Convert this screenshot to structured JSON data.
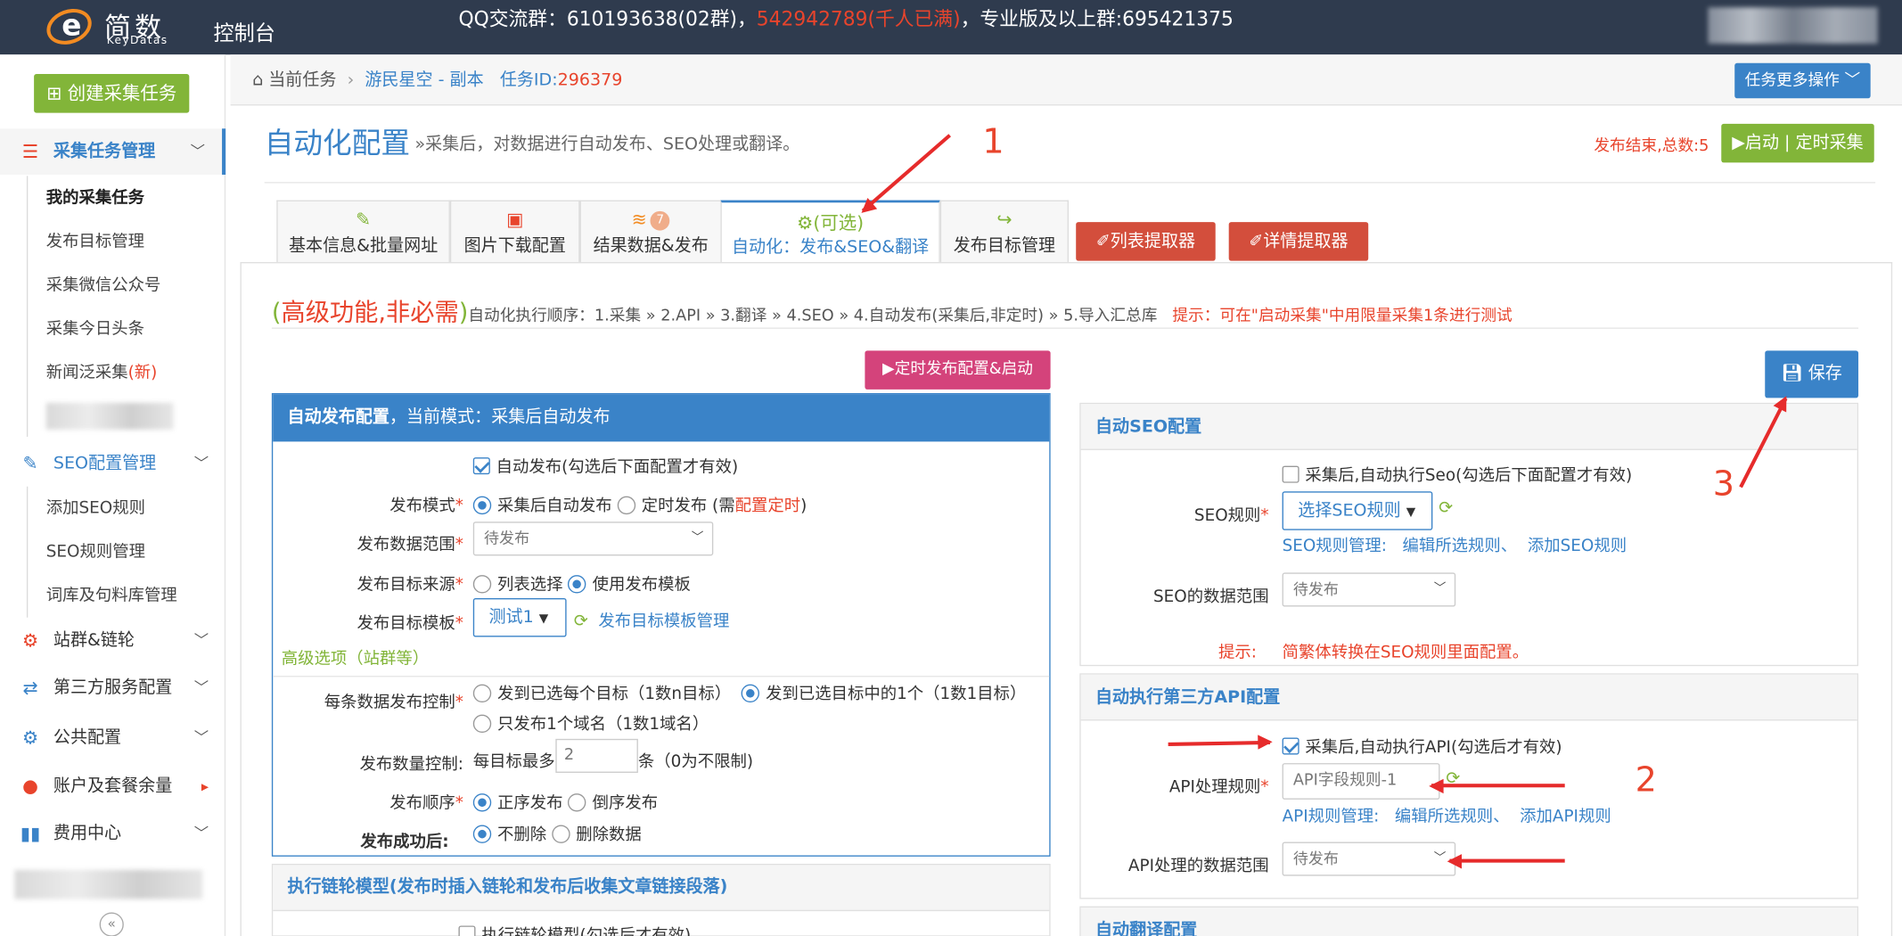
{
  "topbar": {
    "logo_text": "简数",
    "logo_sub": "KeyDatas",
    "console_label": "控制台",
    "qq_prefix": "QQ交流群：610193638(02群)，",
    "qq_full": "542942789(千人已满)",
    "qq_suffix": "，专业版及以上群:695421375"
  },
  "sidebar": {
    "create_button": "创建采集任务",
    "groups": [
      {
        "label": "采集任务管理",
        "icon": "list-icon"
      },
      {
        "label": "SEO配置管理",
        "icon": "edit-icon"
      },
      {
        "label": "站群&链轮",
        "icon": "gears-icon"
      },
      {
        "label": "第三方服务配置",
        "icon": "exchange-icon"
      },
      {
        "label": "公共配置",
        "icon": "gear-icon"
      },
      {
        "label": "账户及套餐余量",
        "icon": "user-icon"
      },
      {
        "label": "费用中心",
        "icon": "bar-chart-icon"
      }
    ],
    "task_items": [
      "我的采集任务",
      "发布目标管理",
      "采集微信公众号",
      "采集今日头条",
      "新闻泛采集"
    ],
    "new_tag": "(新)",
    "seo_items": [
      "添加SEO规则",
      "SEO规则管理",
      "词库及句料库管理"
    ]
  },
  "breadcrumb": {
    "home": "当前任务",
    "task_name": "游民星空 - 副本",
    "task_id_label": "任务ID:",
    "task_id": "296379",
    "more_ops": "任务更多操作"
  },
  "header": {
    "title": "自动化配置",
    "subtitle": "»采集后，对数据进行自动发布、SEO处理或翻译。",
    "publish_end": "发布结束,总数:5",
    "start_button": "▶启动 | 定时采集"
  },
  "tabs": [
    {
      "label": "基本信息&批量网址",
      "icon": "edit-icon"
    },
    {
      "label": "图片下载配置",
      "icon": "image-icon"
    },
    {
      "label": "结果数据&发布",
      "icon": "database-icon",
      "badge": "7"
    },
    {
      "label": "自动化：发布&SEO&翻译",
      "top": "(可选)",
      "icon": "gears-icon"
    },
    {
      "label": "发布目标管理",
      "icon": "share-icon"
    }
  ],
  "extractors": [
    "列表提取器",
    "详情提取器"
  ],
  "advanced": {
    "big": "高级功能,非必需",
    "order": "自动化执行顺序：1.采集 » 2.API » 3.翻译 » 4.SEO » 4.自动发布(采集后,非定时) » 5.导入汇总库",
    "tip": "提示：可在\"启动采集\"中用限量采集1条进行测试"
  },
  "buttons": {
    "schedule": "▶定时发布配置&启动",
    "save": "保存"
  },
  "publish": {
    "head_bold": "自动发布配置",
    "head_rest": "，当前模式：采集后自动发布",
    "auto_publish": "自动发布(勾选后下面配置才有效)",
    "mode_label": "发布模式",
    "mode_after": "采集后自动发布",
    "mode_timed": "定时发布",
    "mode_timed_note_a": "(需",
    "mode_timed_note_link": "配置定时",
    "mode_timed_note_b": ")",
    "range_label": "发布数据范围",
    "range_value": "待发布",
    "source_label": "发布目标来源",
    "source_list": "列表选择",
    "source_template": "使用发布模板",
    "template_label": "发布目标模板",
    "template_value": "测试1",
    "template_manage": "发布目标模板管理",
    "advanced_options": "高级选项（站群等）",
    "per_label": "每条数据发布控制",
    "per_each": "发到已选每个目标（1数n目标）",
    "per_one": "发到已选目标中的1个（1数1目标）",
    "per_domain": "只发布1个域名（1数1域名）",
    "count_label": "发布数量控制:",
    "count_prefix": "每目标最多",
    "count_value": "2",
    "count_suffix": "条（0为不限制)",
    "order_label": "发布顺序",
    "order_asc": "正序发布",
    "order_desc": "倒序发布",
    "after_label": "发布成功后:",
    "after_keep": "不删除",
    "after_delete": "删除数据"
  },
  "chain": {
    "head": "执行链轮模型(发布时插入链轮和发布后收集文章链接段落)",
    "check": "执行链轮模型(勾选后才有效)"
  },
  "seo": {
    "head": "自动SEO配置",
    "check": "采集后,自动执行Seo(勾选后下面配置才有效)",
    "rule_label": "SEO规则",
    "rule_value": "选择SEO规则",
    "manage_label": "SEO规则管理:",
    "edit_link": "编辑所选规则、",
    "add_link": "添加SEO规则",
    "range_label": "SEO的数据范围",
    "range_value": "待发布",
    "tip_label": "提示:",
    "tip_text": "简繁体转换在SEO规则里面配置。"
  },
  "api": {
    "head": "自动执行第三方API配置",
    "check": "采集后,自动执行API(勾选后才有效)",
    "rule_label": "API处理规则",
    "rule_value": "API字段规则-1",
    "manage_label": "API规则管理:",
    "edit_link": "编辑所选规则、",
    "add_link": "添加API规则",
    "range_label": "API处理的数据范围",
    "range_value": "待发布"
  },
  "translate": {
    "head": "自动翻译配置"
  },
  "annotations": [
    "1",
    "2",
    "3"
  ]
}
